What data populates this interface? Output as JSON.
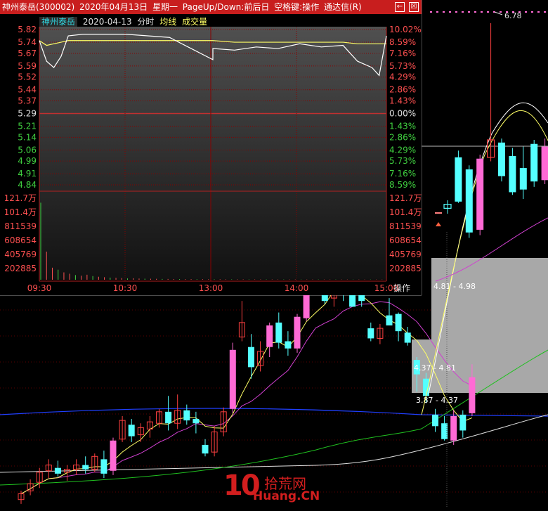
{
  "header": {
    "stock": "神州泰岳(300002)",
    "date": "2020年04月13日",
    "weekday": "星期一",
    "hint": "PageUp/Down:前后日",
    "hint2": "空格键:操作",
    "app": "通达信(R)",
    "back_glyph": "←",
    "close_glyph": "☒"
  },
  "legend": {
    "stock": "神州泰岳",
    "date": "2020-04-13",
    "mode": "分时",
    "avg": "均线",
    "vol": "成交量"
  },
  "axis": {
    "prices_left": [
      "5.82",
      "5.74",
      "5.67",
      "5.59",
      "5.52",
      "5.44",
      "5.37",
      "5.29",
      "5.21",
      "5.14",
      "5.06",
      "4.99",
      "4.91",
      "4.84"
    ],
    "percents_right": [
      "10.02%",
      "8.59%",
      "7.16%",
      "5.73%",
      "4.29%",
      "2.86%",
      "1.43%",
      "0.00%",
      "1.43%",
      "2.86%",
      "4.29%",
      "5.73%",
      "7.16%",
      "8.59%"
    ],
    "volume_labels": [
      "121.7万",
      "101.4万",
      "811539",
      "608654",
      "405769",
      "202885"
    ],
    "times": [
      "09:30",
      "10:30",
      "13:00",
      "14:00",
      "15:00"
    ],
    "op_label": "操作"
  },
  "annotations": {
    "high_label": "6.78",
    "zone1": "4.81 - 4.98",
    "zone2": "4.37 - 4.81",
    "zone3": "3.87 - 4.37"
  },
  "watermark": {
    "brand_num": "10",
    "brand_cn": "拾荒网",
    "url": "Huang.CN"
  },
  "colors": {
    "header_bg": "#c81e1e",
    "up": "#ff6ad5",
    "up_red": "#ff4040",
    "down": "#54ffff",
    "green_bar": "#00e000",
    "price_line": "#ffffff",
    "avg_line": "#ffff66",
    "grid_red": "#8b0000",
    "ma_pink": "#d040d0",
    "ma_green": "#20c020",
    "ma_blue": "#2040ff"
  },
  "chart_data": [
    {
      "type": "line",
      "name_ref": "intraday",
      "ylim": [
        4.84,
        5.82
      ],
      "prev_close": 5.29,
      "x": [
        "09:30",
        "09:35",
        "09:40",
        "09:45",
        "09:50",
        "10:00",
        "10:15",
        "10:30",
        "10:45",
        "11:00",
        "11:15",
        "11:30",
        "13:00",
        "13:15",
        "13:30",
        "13:45",
        "14:00",
        "14:15",
        "14:30",
        "14:40",
        "14:50",
        "14:55",
        "15:00"
      ],
      "price": [
        5.75,
        5.62,
        5.58,
        5.65,
        5.78,
        5.79,
        5.79,
        5.79,
        5.78,
        5.77,
        5.7,
        5.63,
        5.7,
        5.69,
        5.71,
        5.7,
        5.73,
        5.71,
        5.72,
        5.62,
        5.58,
        5.53,
        5.78
      ],
      "avg": [
        5.75,
        5.72,
        5.73,
        5.74,
        5.75,
        5.75,
        5.75,
        5.75,
        5.75,
        5.75,
        5.75,
        5.75,
        5.75,
        5.74,
        5.74,
        5.74,
        5.74,
        5.74,
        5.74,
        5.73,
        5.73,
        5.73,
        5.73
      ]
    },
    {
      "type": "bar",
      "name_ref": "intraday_volume",
      "ylim": [
        0,
        1217000
      ],
      "values": [
        1150000,
        420000,
        180000,
        150000,
        110000,
        90000,
        70000,
        60000,
        75000,
        55000,
        45000,
        38000,
        32000,
        28000,
        25000,
        20000,
        22000,
        18000,
        16000,
        15000,
        14000,
        12000,
        12000,
        11000,
        10000,
        9000,
        9000,
        8500,
        8000,
        7500,
        7000,
        7000,
        6500,
        6000,
        6000,
        5500,
        5500,
        5000,
        5000,
        5000,
        4800,
        4600,
        4500,
        4400,
        4300,
        4200,
        4100,
        4000,
        4000,
        3900,
        3800,
        3800,
        3700,
        3700,
        3600,
        3600,
        3500,
        3500,
        3500,
        3400
      ]
    },
    {
      "type": "candlestick",
      "name_ref": "daily_kline",
      "candles": [
        [
          3.5,
          3.56,
          3.47,
          3.54
        ],
        [
          3.56,
          3.64,
          3.53,
          3.61
        ],
        [
          3.62,
          3.72,
          3.58,
          3.69
        ],
        [
          3.7,
          3.78,
          3.65,
          3.74
        ],
        [
          3.72,
          3.77,
          3.66,
          3.68
        ],
        [
          3.69,
          3.74,
          3.63,
          3.71
        ],
        [
          3.71,
          3.78,
          3.67,
          3.74
        ],
        [
          3.74,
          3.8,
          3.68,
          3.71
        ],
        [
          3.71,
          3.82,
          3.69,
          3.8
        ],
        [
          3.78,
          3.84,
          3.65,
          3.68
        ],
        [
          3.7,
          3.93,
          3.67,
          3.91
        ],
        [
          3.92,
          4.08,
          3.9,
          4.05
        ],
        [
          4.02,
          4.06,
          3.9,
          3.94
        ],
        [
          3.95,
          4.03,
          3.9,
          4.0
        ],
        [
          3.99,
          4.08,
          3.93,
          4.04
        ],
        [
          4.03,
          4.13,
          4.0,
          4.11
        ],
        [
          4.11,
          4.22,
          3.98,
          4.03
        ],
        [
          4.03,
          4.23,
          3.99,
          4.12
        ],
        [
          4.12,
          4.16,
          4.02,
          4.05
        ],
        [
          4.06,
          4.11,
          3.96,
          4.03
        ],
        [
          3.88,
          3.92,
          3.8,
          3.82
        ],
        [
          3.83,
          4.01,
          3.8,
          3.97
        ],
        [
          3.97,
          4.14,
          3.94,
          4.11
        ],
        [
          4.13,
          4.59,
          4.1,
          4.54
        ],
        [
          4.63,
          4.88,
          4.6,
          4.73
        ],
        [
          4.56,
          4.65,
          4.34,
          4.42
        ],
        [
          4.43,
          4.6,
          4.39,
          4.53
        ],
        [
          4.56,
          4.73,
          4.49,
          4.71
        ],
        [
          4.73,
          4.8,
          4.55,
          4.59
        ],
        [
          4.6,
          4.67,
          4.5,
          4.55
        ],
        [
          4.55,
          4.79,
          4.52,
          4.77
        ],
        [
          4.76,
          5.27,
          4.74,
          5.06
        ],
        [
          5.05,
          5.16,
          4.97,
          5.02
        ],
        [
          4.96,
          5.09,
          4.86,
          4.88
        ],
        [
          4.9,
          5.16,
          4.84,
          5.03
        ],
        [
          4.99,
          5.06,
          4.88,
          4.96
        ],
        [
          4.97,
          5.03,
          4.84,
          4.84
        ],
        [
          4.92,
          5.13,
          4.84,
          4.88
        ],
        [
          4.69,
          4.73,
          4.6,
          4.62
        ],
        [
          4.62,
          4.72,
          4.58,
          4.69
        ],
        [
          4.78,
          4.9,
          4.71,
          4.71
        ],
        [
          4.79,
          4.8,
          4.6,
          4.67
        ],
        [
          4.66,
          4.7,
          4.57,
          4.59
        ],
        [
          4.47,
          4.49,
          4.25,
          4.37
        ],
        [
          4.34,
          4.38,
          4.17,
          4.22
        ],
        [
          4.09,
          4.13,
          3.97,
          4.01
        ],
        [
          4.03,
          4.08,
          3.91,
          3.92
        ],
        [
          3.91,
          4.12,
          3.88,
          4.08
        ],
        [
          4.09,
          4.12,
          3.93,
          3.98
        ],
        [
          4.1,
          4.44,
          4.08,
          4.35
        ]
      ],
      "zoom_candles": [
        [
          5.43,
          5.46,
          5.36,
          5.4
        ],
        [
          5.78,
          5.83,
          5.44,
          5.45
        ],
        [
          5.69,
          5.72,
          5.18,
          5.22
        ],
        [
          5.24,
          5.8,
          5.2,
          5.77
        ],
        [
          5.78,
          6.78,
          5.75,
          5.91
        ],
        [
          5.89,
          5.92,
          5.6,
          5.64
        ],
        [
          5.79,
          5.85,
          5.5,
          5.52
        ],
        [
          5.7,
          5.86,
          5.47,
          5.54
        ],
        [
          5.88,
          5.91,
          5.56,
          5.6
        ],
        [
          5.61,
          5.92,
          5.58,
          5.86
        ]
      ]
    }
  ]
}
